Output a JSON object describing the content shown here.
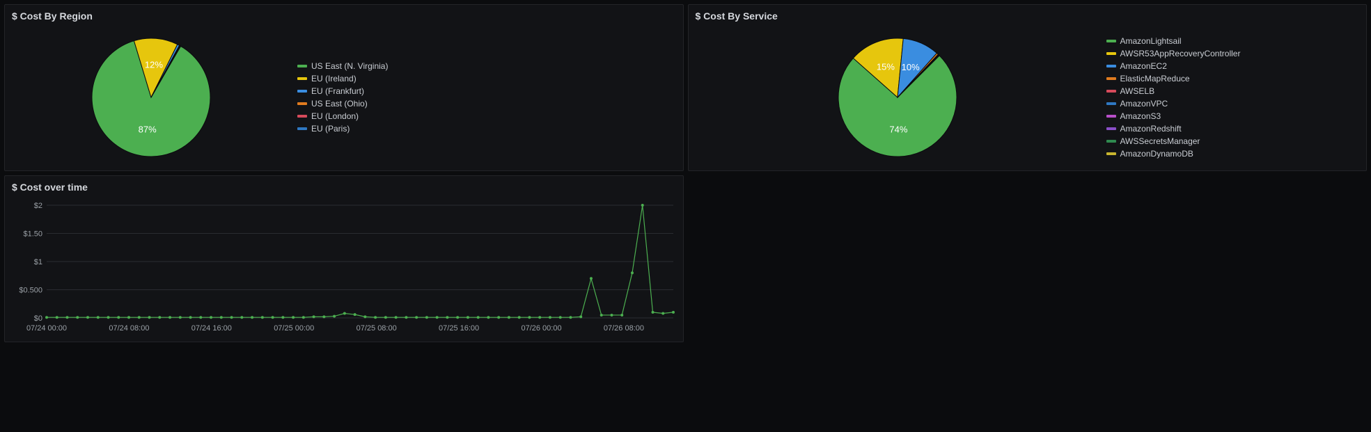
{
  "panels": {
    "region": {
      "title": "$ Cost By Region"
    },
    "service": {
      "title": "$ Cost By Service"
    },
    "time": {
      "title": "$ Cost over time"
    }
  },
  "chart_data": [
    {
      "id": "cost_by_region",
      "type": "pie",
      "title": "$ Cost By Region",
      "series": [
        {
          "name": "US East (N. Virginia)",
          "value": 87,
          "color": "#4caf50",
          "label": "87%"
        },
        {
          "name": "EU (Ireland)",
          "value": 12,
          "color": "#e6c60d",
          "label": "12%"
        },
        {
          "name": "EU (Frankfurt)",
          "value": 0.6,
          "color": "#3a8de0",
          "label": ""
        },
        {
          "name": "US East (Ohio)",
          "value": 0.2,
          "color": "#e07b1f",
          "label": ""
        },
        {
          "name": "EU (London)",
          "value": 0.1,
          "color": "#d64a5b",
          "label": ""
        },
        {
          "name": "EU (Paris)",
          "value": 0.1,
          "color": "#2f78c2",
          "label": ""
        }
      ]
    },
    {
      "id": "cost_by_service",
      "type": "pie",
      "title": "$ Cost By Service",
      "series": [
        {
          "name": "AmazonLightsail",
          "value": 74,
          "color": "#4caf50",
          "label": "74%"
        },
        {
          "name": "AWSR53AppRecoveryController",
          "value": 15,
          "color": "#e6c60d",
          "label": "15%"
        },
        {
          "name": "AmazonEC2",
          "value": 10,
          "color": "#3a8de0",
          "label": "10%"
        },
        {
          "name": "ElasticMapReduce",
          "value": 0.5,
          "color": "#e07b1f",
          "label": ""
        },
        {
          "name": "AWSELB",
          "value": 0.2,
          "color": "#d64a5b",
          "label": ""
        },
        {
          "name": "AmazonVPC",
          "value": 0.1,
          "color": "#2f78c2",
          "label": ""
        },
        {
          "name": "AmazonS3",
          "value": 0.05,
          "color": "#b84fc9",
          "label": ""
        },
        {
          "name": "AmazonRedshift",
          "value": 0.05,
          "color": "#8a4fc9",
          "label": ""
        },
        {
          "name": "AWSSecretsManager",
          "value": 0.03,
          "color": "#2f8a4f",
          "label": ""
        },
        {
          "name": "AmazonDynamoDB",
          "value": 0.02,
          "color": "#c8b52f",
          "label": ""
        }
      ]
    },
    {
      "id": "cost_over_time",
      "type": "line",
      "title": "$ Cost over time",
      "ylabel": "$",
      "ylim": [
        0,
        2
      ],
      "y_ticks": [
        "$0",
        "$0.500",
        "$1",
        "$1.50",
        "$2"
      ],
      "x_ticks": [
        "07/24 00:00",
        "07/24 08:00",
        "07/24 16:00",
        "07/25 00:00",
        "07/25 08:00",
        "07/25 16:00",
        "07/26 00:00",
        "07/26 08:00"
      ],
      "series": [
        {
          "name": "Cost",
          "color": "#4caf50",
          "x": [
            "07/24 00:00",
            "07/24 01:00",
            "07/24 02:00",
            "07/24 03:00",
            "07/24 04:00",
            "07/24 05:00",
            "07/24 06:00",
            "07/24 07:00",
            "07/24 08:00",
            "07/24 09:00",
            "07/24 10:00",
            "07/24 11:00",
            "07/24 12:00",
            "07/24 13:00",
            "07/24 14:00",
            "07/24 15:00",
            "07/24 16:00",
            "07/24 17:00",
            "07/24 18:00",
            "07/24 19:00",
            "07/24 20:00",
            "07/24 21:00",
            "07/24 22:00",
            "07/24 23:00",
            "07/25 00:00",
            "07/25 01:00",
            "07/25 02:00",
            "07/25 03:00",
            "07/25 04:00",
            "07/25 05:00",
            "07/25 06:00",
            "07/25 07:00",
            "07/25 08:00",
            "07/25 09:00",
            "07/25 10:00",
            "07/25 11:00",
            "07/25 12:00",
            "07/25 13:00",
            "07/25 14:00",
            "07/25 15:00",
            "07/25 16:00",
            "07/25 17:00",
            "07/25 18:00",
            "07/25 19:00",
            "07/25 20:00",
            "07/25 21:00",
            "07/25 22:00",
            "07/25 23:00",
            "07/26 00:00",
            "07/26 01:00",
            "07/26 02:00",
            "07/26 03:00",
            "07/26 04:00",
            "07/26 05:00",
            "07/26 06:00",
            "07/26 07:00",
            "07/26 08:00",
            "07/26 09:00",
            "07/26 10:00",
            "07/26 11:00",
            "07/26 12:00",
            "07/26 13:00"
          ],
          "values": [
            0.01,
            0.01,
            0.01,
            0.01,
            0.01,
            0.01,
            0.01,
            0.01,
            0.01,
            0.01,
            0.01,
            0.01,
            0.01,
            0.01,
            0.01,
            0.01,
            0.01,
            0.01,
            0.01,
            0.01,
            0.01,
            0.01,
            0.01,
            0.01,
            0.01,
            0.01,
            0.02,
            0.02,
            0.03,
            0.08,
            0.06,
            0.02,
            0.01,
            0.01,
            0.01,
            0.01,
            0.01,
            0.01,
            0.01,
            0.01,
            0.01,
            0.01,
            0.01,
            0.01,
            0.01,
            0.01,
            0.01,
            0.01,
            0.01,
            0.01,
            0.01,
            0.01,
            0.02,
            0.7,
            0.05,
            0.05,
            0.05,
            0.8,
            2.0,
            0.1,
            0.08,
            0.1
          ]
        }
      ]
    }
  ]
}
